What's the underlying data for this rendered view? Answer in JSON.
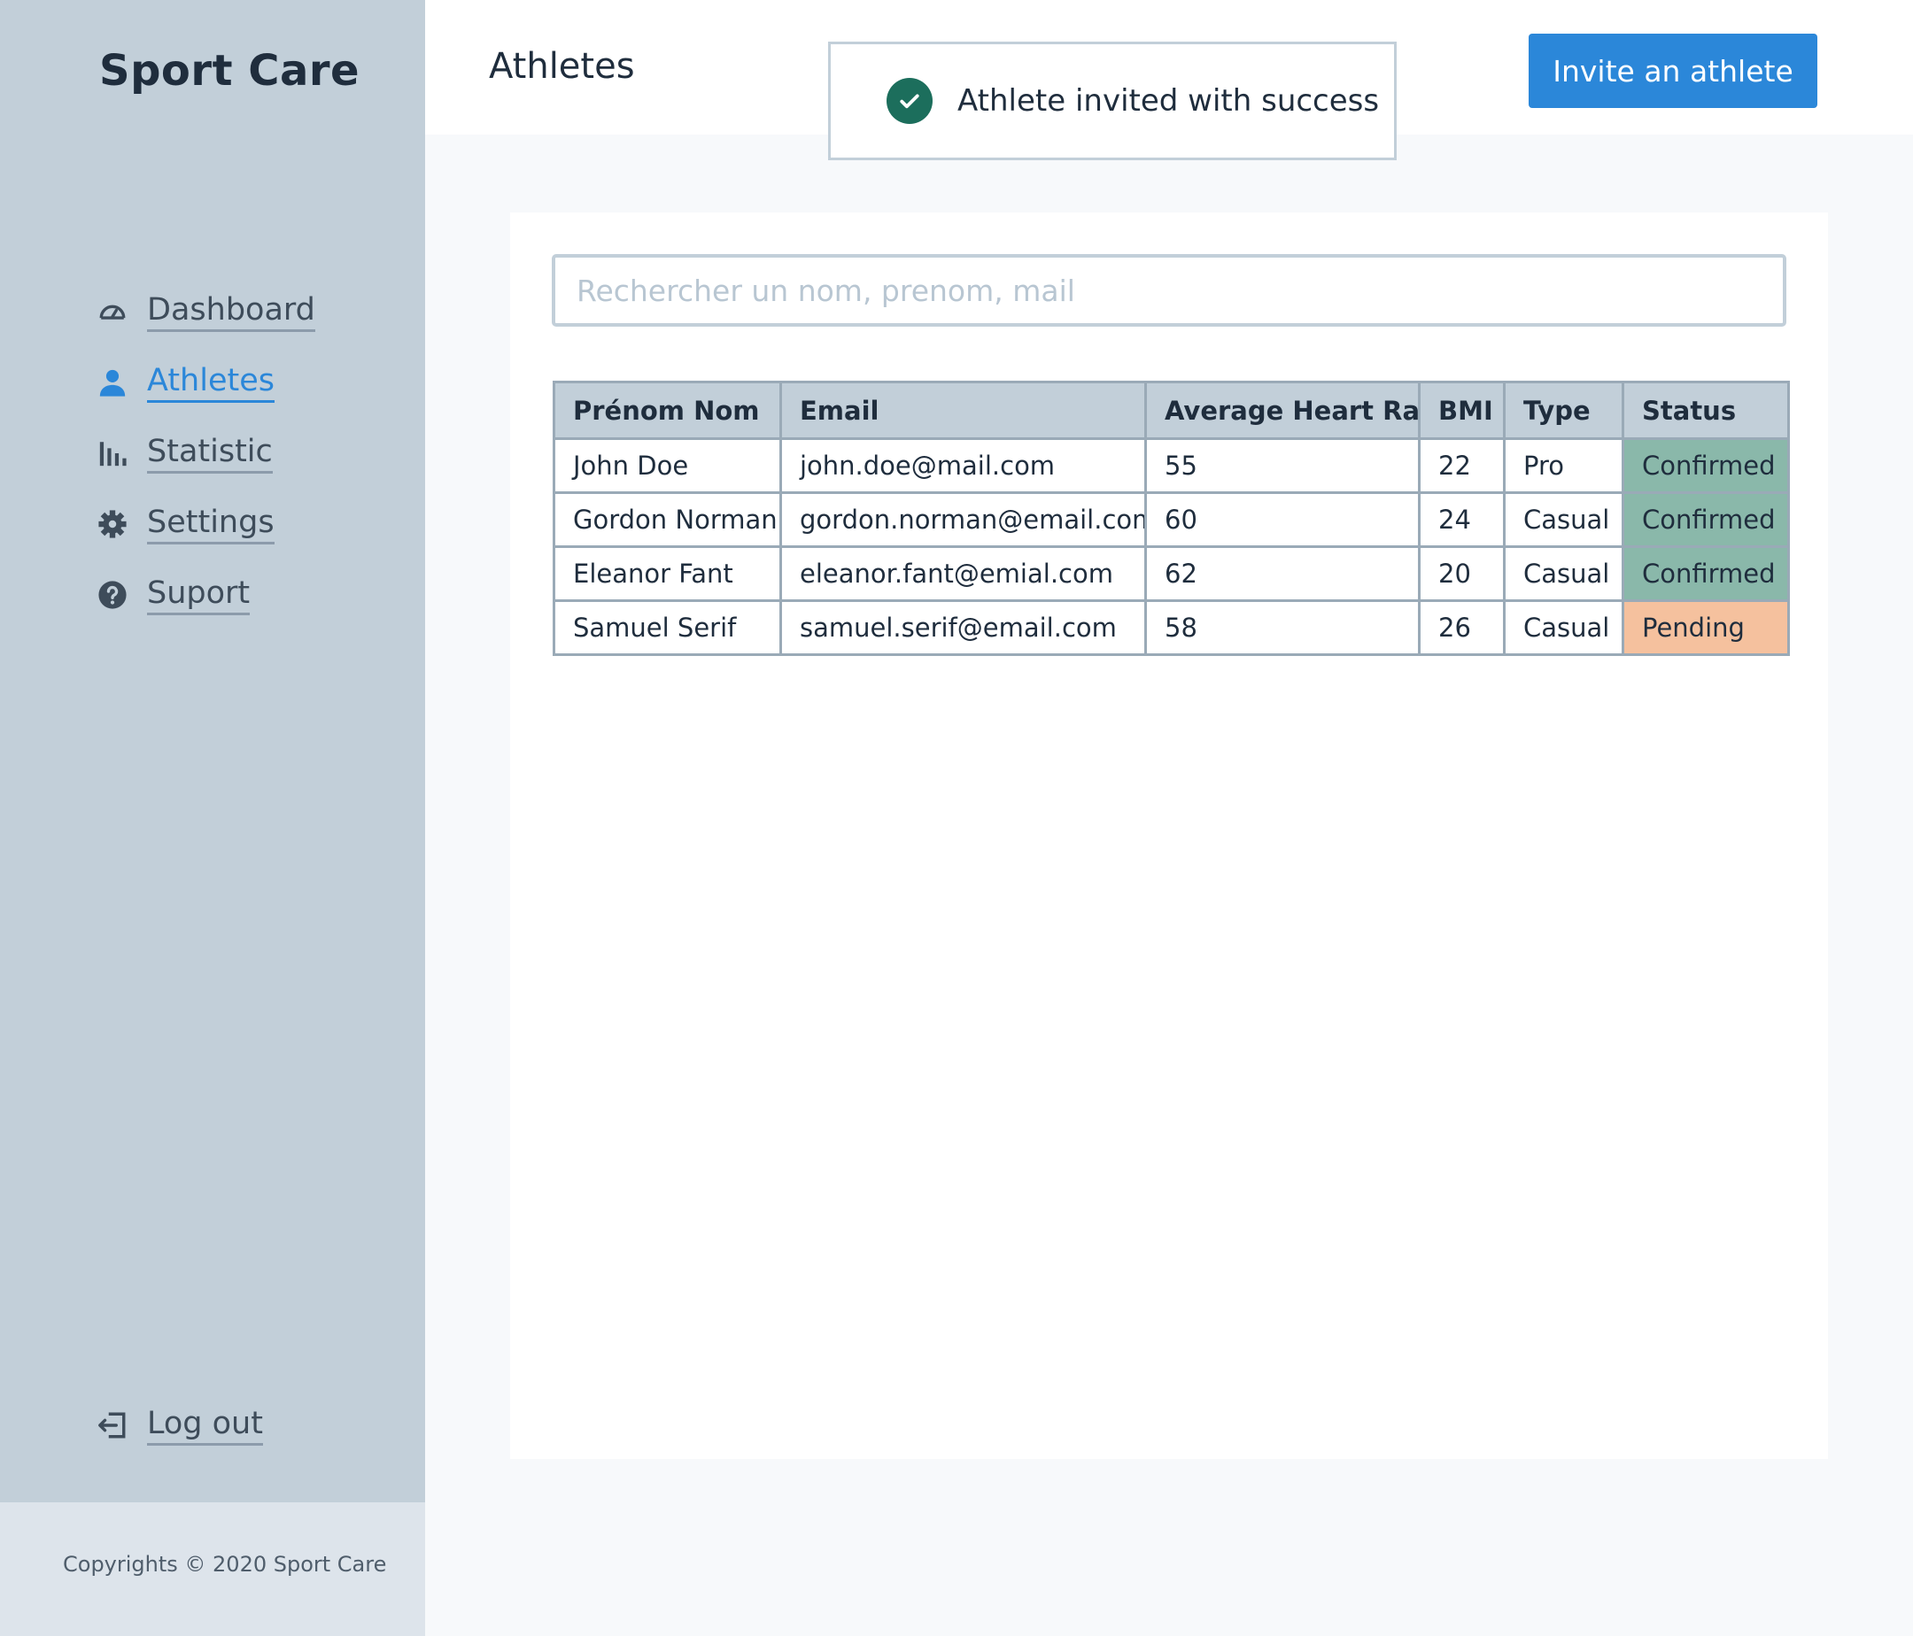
{
  "brand": "Sport Care",
  "sidebar": {
    "items": [
      {
        "label": "Dashboard",
        "icon": "dashboard-icon"
      },
      {
        "label": "Athletes",
        "icon": "user-icon",
        "active": true
      },
      {
        "label": "Statistic",
        "icon": "bar-chart-icon"
      },
      {
        "label": "Settings",
        "icon": "gear-icon"
      },
      {
        "label": "Suport",
        "icon": "help-icon"
      }
    ],
    "logout": {
      "label": "Log out",
      "icon": "logout-icon"
    }
  },
  "footer": {
    "text": "Copyrights © 2020 Sport Care"
  },
  "header": {
    "title": "Athletes",
    "invite_label": "Invite an athlete"
  },
  "toast": {
    "message": "Athlete invited with success",
    "icon": "check-circle-icon"
  },
  "search": {
    "placeholder": "Rechercher un nom, prenom, mail",
    "value": ""
  },
  "table": {
    "columns": [
      "Prénom Nom",
      "Email",
      "Average Heart Rate",
      "BMI",
      "Type",
      "Status"
    ],
    "rows": [
      {
        "name": "John Doe",
        "email": "john.doe@mail.com",
        "heart_rate": "55",
        "bmi": "22",
        "type": "Pro",
        "status": "Confirmed"
      },
      {
        "name": "Gordon Norman",
        "email": "gordon.norman@email.com",
        "heart_rate": "60",
        "bmi": "24",
        "type": "Casual",
        "status": "Confirmed"
      },
      {
        "name": "Eleanor Fant",
        "email": "eleanor.fant@emial.com",
        "heart_rate": "62",
        "bmi": "20",
        "type": "Casual",
        "status": "Confirmed"
      },
      {
        "name": "Samuel Serif",
        "email": "samuel.serif@email.com",
        "heart_rate": "58",
        "bmi": "26",
        "type": "Casual",
        "status": "Pending"
      }
    ]
  },
  "colors": {
    "accent": "#2b87d9",
    "sidebar_bg": "#c2cfd9",
    "confirmed": "#8ab8aa",
    "pending": "#f5c19e",
    "toast_icon": "#1c6e5c"
  }
}
